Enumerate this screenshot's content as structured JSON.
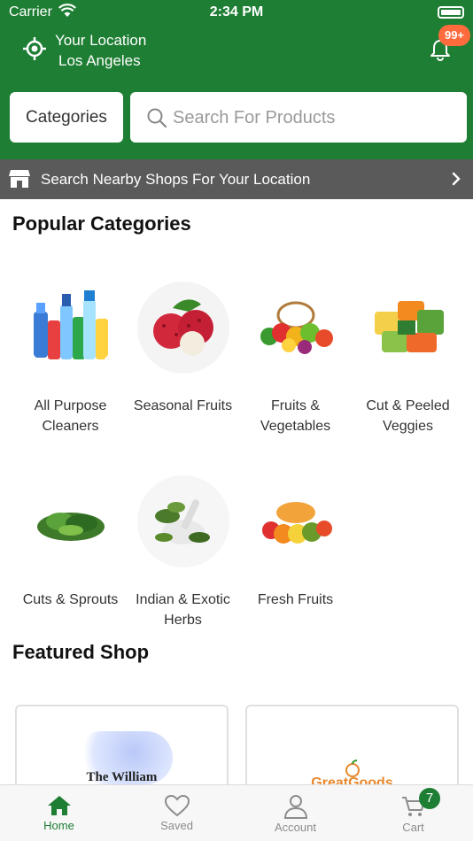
{
  "status_bar": {
    "carrier": "Carrier",
    "time": "2:34 PM"
  },
  "location": {
    "label": "Your Location",
    "city": "Los Angeles"
  },
  "notifications": {
    "count_badge": "99+"
  },
  "categories_button": "Categories",
  "search": {
    "placeholder": "Search For Products"
  },
  "nearby_banner": {
    "label": "Search Nearby Shops For Your Location"
  },
  "popular": {
    "title": "Popular Categories",
    "items": [
      {
        "name": "All Purpose Cleaners",
        "icon": "cleaners-image"
      },
      {
        "name": "Seasonal Fruits",
        "icon": "lychee-image"
      },
      {
        "name": "Fruits & Vegetables",
        "icon": "fruits-vegetables-image"
      },
      {
        "name": "Cut & Peeled Veggies",
        "icon": "cut-veggies-image"
      },
      {
        "name": "Cuts & Sprouts",
        "icon": "sprouts-image"
      },
      {
        "name": "Indian & Exotic Herbs",
        "icon": "herbs-image"
      },
      {
        "name": "Fresh Fruits",
        "icon": "fresh-fruits-image"
      }
    ]
  },
  "featured": {
    "title": "Featured Shop",
    "shops": [
      {
        "logo_text": "The William"
      },
      {
        "logo_text": "GreatGoods"
      }
    ]
  },
  "tabbar": {
    "tabs": [
      {
        "label": "Home",
        "icon": "home-icon",
        "active": true
      },
      {
        "label": "Saved",
        "icon": "heart-icon"
      },
      {
        "label": "Account",
        "icon": "user-icon"
      },
      {
        "label": "Cart",
        "icon": "cart-icon"
      }
    ],
    "cart_count": "7"
  },
  "colors": {
    "primary": "#1e7e34",
    "badge": "#ff6b3d",
    "banner": "#5a5a5a"
  }
}
